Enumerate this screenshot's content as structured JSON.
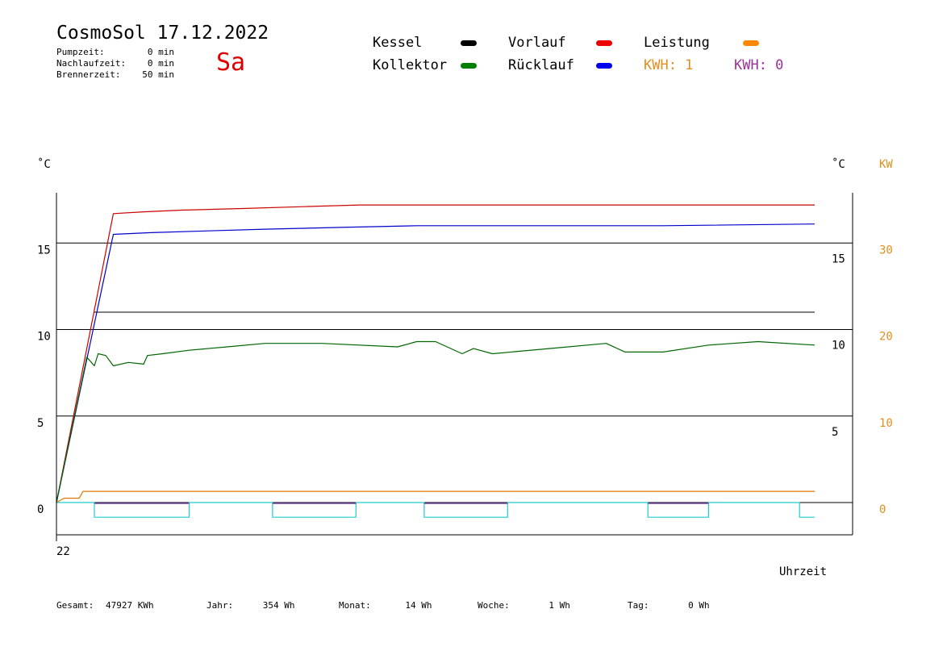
{
  "header": {
    "title": "CosmoSol 17.12.2022",
    "weekday": "Sa",
    "stats": [
      {
        "label": "Pumpzeit:",
        "value": "0 min"
      },
      {
        "label": "Nachlaufzeit:",
        "value": "0 min"
      },
      {
        "label": "Brennerzeit:",
        "value": "50 min"
      }
    ]
  },
  "legend": {
    "items": [
      {
        "label": "Kessel",
        "color": "#000000"
      },
      {
        "label": "Vorlauf",
        "color": "#ee0000"
      },
      {
        "label": "Leistung",
        "color": "#ff8800"
      },
      {
        "label": "Kollektor",
        "color": "#008000"
      },
      {
        "label": "Rücklauf",
        "color": "#0000ee"
      }
    ],
    "kwh_1": {
      "text": "KWH: 1",
      "color": "#e09020"
    },
    "kwh_0": {
      "text": "KWH: 0",
      "color": "#993399"
    }
  },
  "chart_data": {
    "type": "line",
    "left_axis": {
      "unit": "˚C",
      "ticks": [
        0,
        5,
        10,
        15
      ],
      "range": [
        -1.8,
        17.8
      ]
    },
    "right_axis_temp": {
      "unit": "˚C",
      "ticks": [
        5,
        10,
        15
      ]
    },
    "right_axis_power": {
      "unit": "KW",
      "ticks": [
        0,
        10,
        20,
        30
      ],
      "range": [
        0,
        30
      ]
    },
    "x_axis": {
      "label": "Uhrzeit",
      "tick_labels": [
        "22"
      ],
      "range": [
        22.0,
        24.0
      ]
    },
    "reference_lines": [
      {
        "value": 11.0,
        "x_start": 22.1,
        "x_end": 24.0,
        "color": "#000000"
      }
    ],
    "series": [
      {
        "name": "Vorlauf",
        "color": "#cc0000",
        "x": [
          22.0,
          22.15,
          22.23,
          22.33,
          22.5,
          22.65,
          22.8,
          23.0,
          23.5,
          24.0
        ],
        "y": [
          0.0,
          16.7,
          16.8,
          16.9,
          17.0,
          17.1,
          17.2,
          17.2,
          17.2,
          17.2
        ]
      },
      {
        "name": "Rücklauf",
        "color": "#0000cc",
        "x": [
          22.0,
          22.15,
          22.25,
          22.4,
          22.55,
          22.75,
          22.95,
          23.2,
          23.6,
          24.0
        ],
        "y": [
          0.0,
          15.5,
          15.6,
          15.7,
          15.8,
          15.9,
          16.0,
          16.0,
          16.0,
          16.1
        ]
      },
      {
        "name": "Kollektor",
        "color": "#006600",
        "x": [
          22.0,
          22.08,
          22.1,
          22.11,
          22.13,
          22.15,
          22.19,
          22.23,
          22.24,
          22.28,
          22.35,
          22.45,
          22.55,
          22.7,
          22.9,
          22.95,
          23.0,
          23.07,
          23.1,
          23.15,
          23.3,
          23.45,
          23.5,
          23.55,
          23.6,
          23.72,
          23.85,
          24.0
        ],
        "y": [
          0.0,
          8.4,
          7.9,
          8.6,
          8.5,
          7.9,
          8.1,
          8.0,
          8.5,
          8.6,
          8.8,
          9.0,
          9.2,
          9.2,
          9.0,
          9.3,
          9.3,
          8.6,
          8.9,
          8.6,
          8.9,
          9.2,
          8.7,
          8.7,
          8.7,
          9.1,
          9.3,
          9.1
        ]
      },
      {
        "name": "Leistung",
        "color": "#dd7700",
        "axis": "power",
        "x": [
          22.0,
          22.02,
          22.06,
          22.07,
          24.0
        ],
        "y": [
          0.0,
          0.5,
          0.5,
          1.3,
          1.3
        ]
      },
      {
        "name": "Pumpe",
        "color": "#22cccc",
        "x": [
          22.0,
          22.1,
          22.1,
          22.35,
          22.35,
          22.57,
          22.57,
          22.79,
          22.79,
          22.97,
          22.97,
          23.19,
          23.19,
          23.56,
          23.56,
          23.72,
          23.72,
          23.96,
          23.96,
          24.0
        ],
        "y": [
          0.0,
          0.0,
          -0.85,
          -0.85,
          0.0,
          0.0,
          -0.85,
          -0.85,
          0.0,
          0.0,
          -0.85,
          -0.85,
          0.0,
          0.0,
          -0.85,
          -0.85,
          0.0,
          0.0,
          -0.85,
          -0.85
        ]
      },
      {
        "name": "Pumpe Stufe",
        "color": "#7744aa",
        "x": [
          22.1,
          22.35,
          22.57,
          22.79,
          22.97,
          23.19,
          23.56,
          23.72
        ],
        "y": [
          0.0,
          0.0,
          0.0,
          0.0,
          0.0,
          0.0,
          0.0,
          0.0
        ],
        "segments": [
          [
            22.1,
            22.35
          ],
          [
            22.57,
            22.79
          ],
          [
            22.97,
            23.19
          ],
          [
            23.56,
            23.72
          ]
        ]
      }
    ]
  },
  "footer": {
    "items": [
      {
        "label": "Gesamt:",
        "value": "47927 KWh"
      },
      {
        "label": "Jahr:",
        "value": "354 Wh"
      },
      {
        "label": "Monat:",
        "value": "14 Wh"
      },
      {
        "label": "Woche:",
        "value": "1 Wh"
      },
      {
        "label": "Tag:",
        "value": "0 Wh"
      }
    ]
  }
}
